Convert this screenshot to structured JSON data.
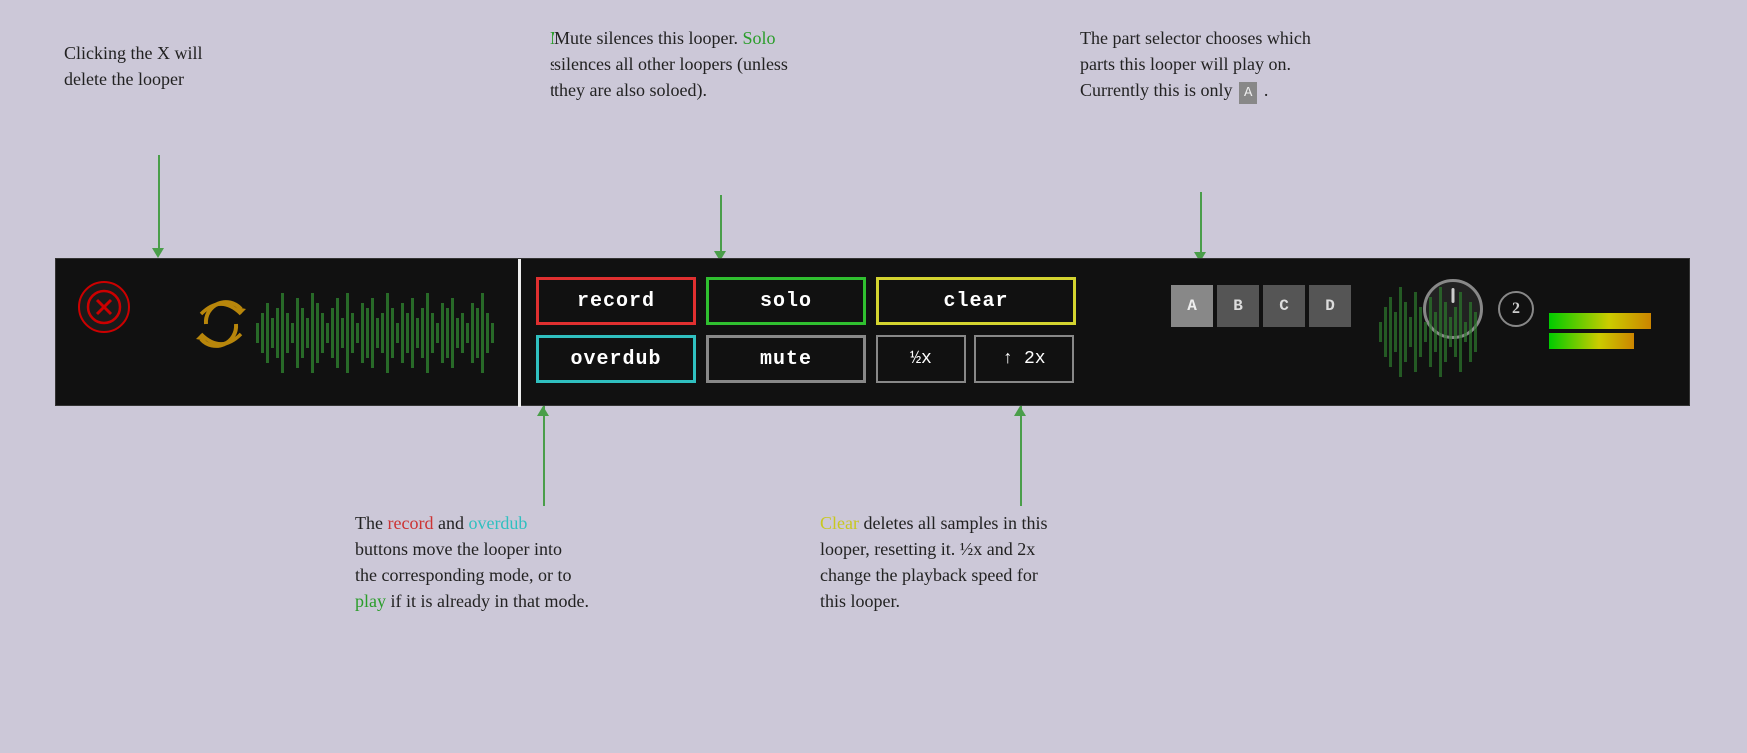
{
  "background_color": "#ccc8d8",
  "annotations": {
    "top_left": {
      "line1": "Clicking the X will",
      "line2": "delete the looper"
    },
    "top_center": {
      "line1": "Mute silences this looper. Solo",
      "line2": "silences all other loopers (unless",
      "line3": "they are also soloed)."
    },
    "top_right": {
      "line1": "The part selector chooses which",
      "line2": "parts this looper will play on.",
      "line3_prefix": "Currently this is only",
      "line3_badge": "A",
      "line3_suffix": "."
    },
    "bottom_center_left": {
      "prefix": "The",
      "record": "record",
      "middle1": "and",
      "overdub": "overdub",
      "line2": "buttons move the looper into",
      "line3": "the corresponding mode, or to",
      "play": "play",
      "line4": "if it is already in that mode."
    },
    "bottom_center_right": {
      "clear": "Clear",
      "line1_suffix": "deletes all samples in this",
      "line2": "looper, resetting it. ½x and 2x",
      "line3": "change the playback speed for",
      "line4": "this looper."
    }
  },
  "looper": {
    "buttons": {
      "record": "record",
      "overdub": "overdub",
      "solo": "solo",
      "mute": "mute",
      "clear": "clear",
      "half_speed": "½x",
      "double_speed": "↑ 2x"
    },
    "parts": [
      "A",
      "B",
      "C",
      "D"
    ],
    "channel_number": "2"
  },
  "arrows": {
    "color": "#4a9e4a"
  }
}
